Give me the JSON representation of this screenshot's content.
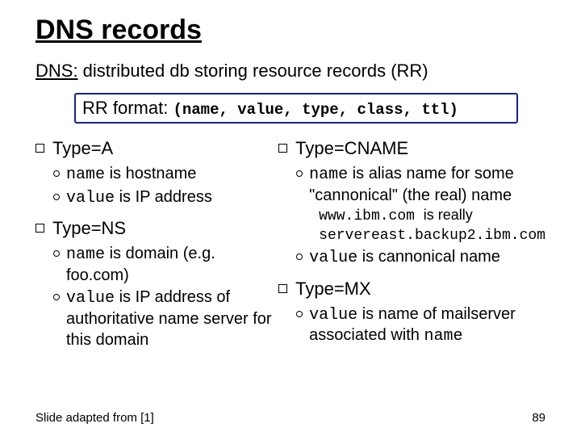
{
  "title": "DNS records",
  "subtitle_prefix": "DNS:",
  "subtitle_rest": " distributed db storing resource records (RR)",
  "rr_label": "RR format: ",
  "rr_tuple": "(name, value, type, class, ttl)",
  "left": {
    "sectionA": {
      "heading": "Type=A",
      "items": [
        {
          "mono": "name",
          "rest": " is hostname"
        },
        {
          "mono": "value",
          "rest": " is IP address"
        }
      ]
    },
    "sectionNS": {
      "heading": "Type=NS",
      "items": [
        {
          "mono": "name",
          "rest": " is domain (e.g. foo.com)"
        },
        {
          "mono": "value",
          "rest": " is IP address of authoritative name server for this domain"
        }
      ]
    }
  },
  "right": {
    "sectionCNAME": {
      "heading": "Type=CNAME",
      "items": [
        {
          "mono": "name",
          "rest": " is alias name for some \"cannonical\" (the real) name",
          "example1": "www.ibm.com ",
          "example1_tail": "is really",
          "example2": "servereast.backup2.ibm.com"
        },
        {
          "mono": "value",
          "rest": " is cannonical name"
        }
      ]
    },
    "sectionMX": {
      "heading": "Type=MX",
      "items": [
        {
          "mono": "value",
          "rest_a": " is name of mailserver associated with ",
          "mono_b": "name"
        }
      ]
    }
  },
  "footer_left": "Slide adapted from [1]",
  "footer_right": "89"
}
